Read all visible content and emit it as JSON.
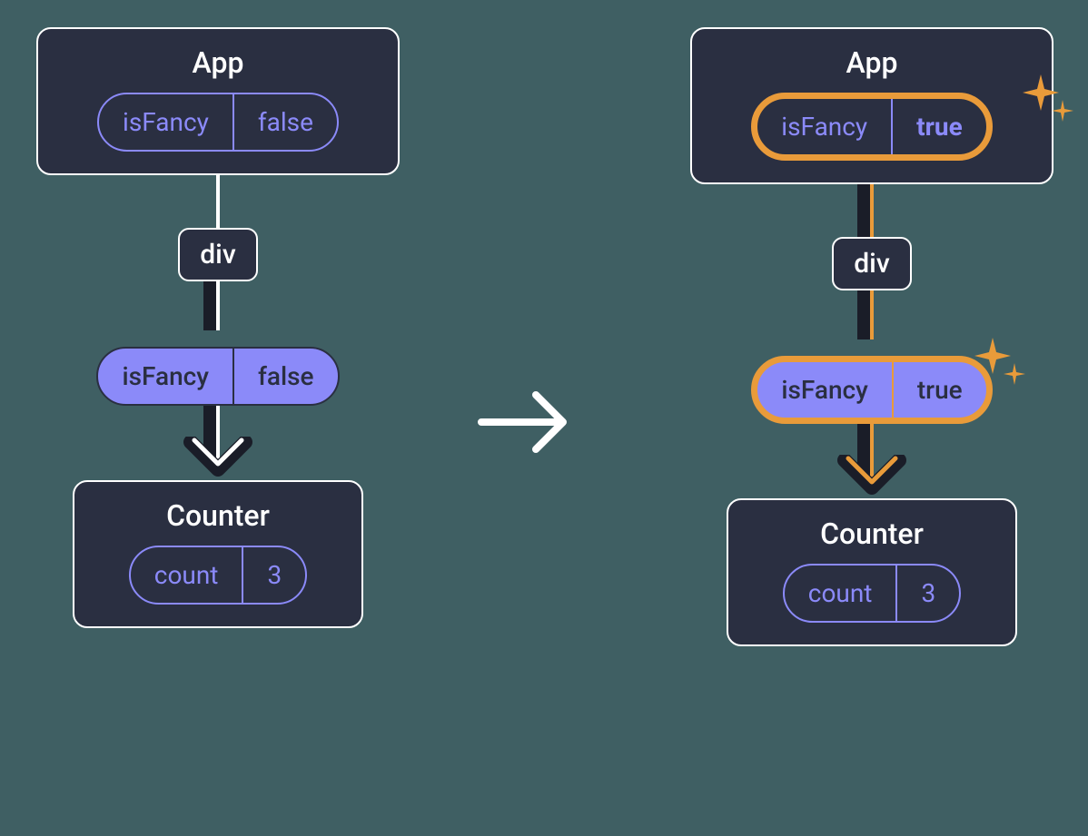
{
  "left": {
    "app": {
      "title": "App",
      "state_key": "isFancy",
      "state_value": "false"
    },
    "div": {
      "title": "div"
    },
    "prop": {
      "key": "isFancy",
      "value": "false"
    },
    "counter": {
      "title": "Counter",
      "state_key": "count",
      "state_value": "3"
    }
  },
  "right": {
    "app": {
      "title": "App",
      "state_key": "isFancy",
      "state_value": "true"
    },
    "div": {
      "title": "div"
    },
    "prop": {
      "key": "isFancy",
      "value": "true"
    },
    "counter": {
      "title": "Counter",
      "state_key": "count",
      "state_value": "3"
    }
  },
  "colors": {
    "bg": "#3f5f63",
    "node_bg": "#2a2f41",
    "node_border": "#ffffff",
    "accent": "#8b8af9",
    "highlight": "#e99b3a",
    "shadow": "#1a1d28"
  }
}
